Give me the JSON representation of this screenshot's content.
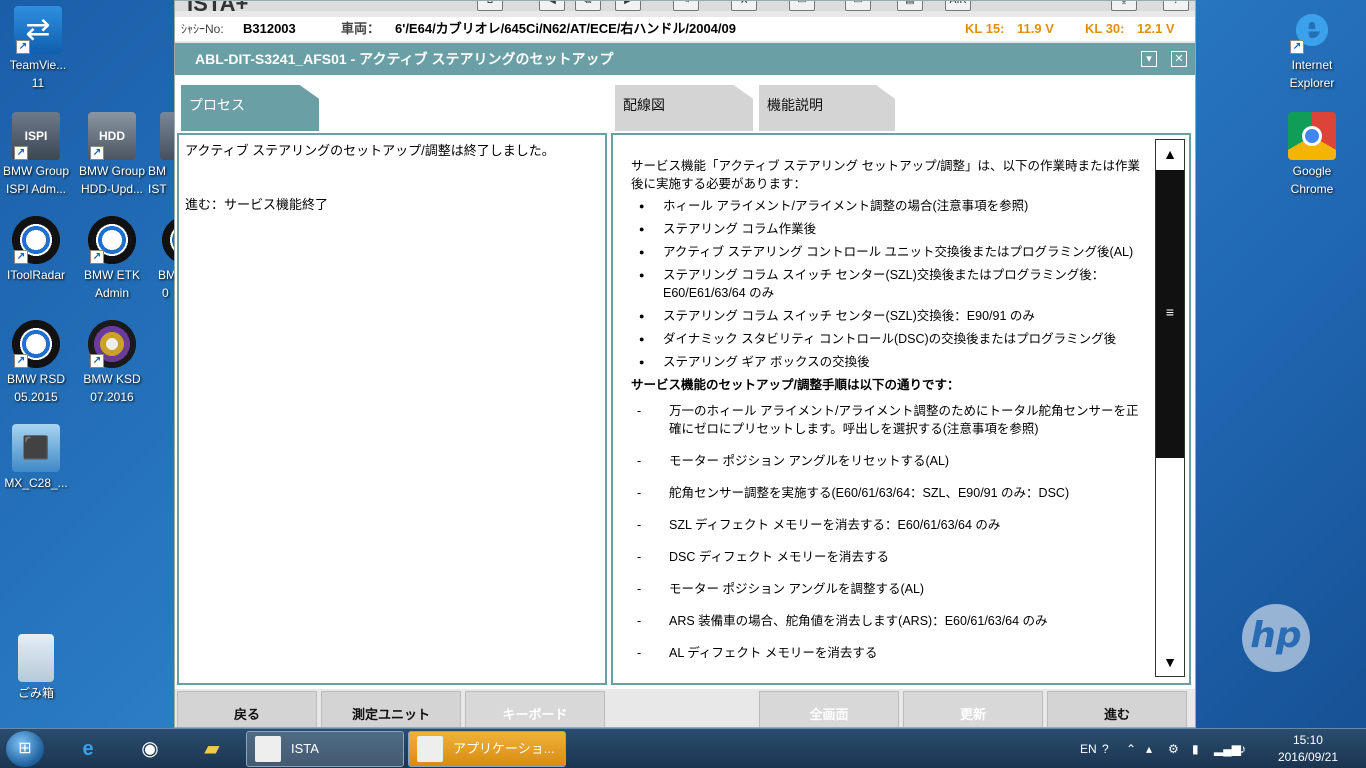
{
  "desktop": {
    "icons": [
      {
        "name": "TeamViewer",
        "label1": "TeamVie...",
        "label2": "11"
      },
      {
        "name": "ISPI Admin",
        "label1": "BMW Group",
        "label2": "ISPI Adm..."
      },
      {
        "name": "HDD Update",
        "label1": "BMW Group",
        "label2": "HDD-Upd..."
      },
      {
        "name": "IST",
        "label1": "BM",
        "label2": "IST"
      },
      {
        "name": "IToolRadar",
        "label1": "IToolRadar",
        "label2": ""
      },
      {
        "name": "ETK Admin",
        "label1": "BMW ETK",
        "label2": "Admin"
      },
      {
        "name": "BMW other",
        "label1": "BM",
        "label2": "0"
      },
      {
        "name": "RSD",
        "label1": "BMW RSD",
        "label2": "05.2015"
      },
      {
        "name": "KSD",
        "label1": "BMW KSD",
        "label2": "07.2016"
      },
      {
        "name": "MX",
        "label1": "MX_C28_...",
        "label2": ""
      },
      {
        "name": "Recycle Bin",
        "label1": "ごみ箱",
        "label2": ""
      },
      {
        "name": "IE",
        "label1": "Internet",
        "label2": "Explorer"
      },
      {
        "name": "Chrome",
        "label1": "Google",
        "label2": "Chrome"
      }
    ],
    "hp_logo": "hp"
  },
  "app": {
    "title": "ISTA+",
    "vehicle": {
      "chassis_label": "ｼｬｼｰNo:",
      "chassis_value": "B312003",
      "vehicle_label": "車両：",
      "vehicle_value": "6'/E64/カブリオレ/645Ci/N62/AT/ECE/右ハンドル/2004/09",
      "kl15_label": "KL 15:",
      "kl15_value": "11.9 V",
      "kl30_label": "KL 30:",
      "kl30_value": "12.1 V"
    },
    "window_title": "ABL-DIT-S3241_AFS01 - アクティブ ステアリングのセットアップ",
    "tabs": {
      "process": "プロセス",
      "wiring": "配線図",
      "function": "機能説明"
    },
    "left_panel": {
      "message": "アクティブ ステアリングのセットアップ/調整は終了しました。",
      "next_hint": "進む：サービス機能終了"
    },
    "right_panel": {
      "intro": "サービス機能「アクティブ ステアリング セットアップ/調整」は、以下の作業時または作業後に実施する必要があります：",
      "bullets": [
        "ホィール アライメント/アライメント調整の場合(注意事項を参照)",
        "ステアリング コラム作業後",
        "アクティブ ステアリング コントロール ユニット交換後またはプログラミング後(AL)",
        "ステアリング コラム スイッチ センター(SZL)交換後またはプログラミング後：E60/E61/63/64 のみ",
        "ステアリング コラム スイッチ センター(SZL)交換後：E90/91 のみ",
        "ダイナミック スタビリティ コントロール(DSC)の交換後またはプログラミング後",
        "ステアリング ギア ボックスの交換後"
      ],
      "procedure_title": "サービス機能のセットアップ/調整手順は以下の通りです：",
      "steps": [
        "万一のホィール アライメント/アライメント調整のためにトータル舵角センサーを正確にゼロにプリセットします。呼出しを選択する(注意事項を参照)",
        "モーター ポジション アングルをリセットする(AL)",
        "舵角センサー調整を実施する(E60/61/63/64：SZL、E90/91 のみ：DSC)",
        "SZL ディフェクト メモリーを消去する：E60/61/63/64 のみ",
        "DSC ディフェクト メモリーを消去する",
        "モーター ポジション アングルを調整する(AL)",
        "ARS 装備車の場合、舵角値を消去します(ARS)：E60/61/63/64 のみ",
        "AL ディフェクト メモリーを消去する"
      ]
    },
    "buttons": {
      "back": "戻る",
      "measure": "測定ユニット",
      "keyboard": "キーボード",
      "fullscreen": "全画面",
      "update": "更新",
      "next": "進む"
    }
  },
  "taskbar": {
    "task_ista": "ISTA",
    "task_app": "アプリケーショ...",
    "lang": "EN",
    "time": "15:10",
    "date": "2016/09/21"
  }
}
